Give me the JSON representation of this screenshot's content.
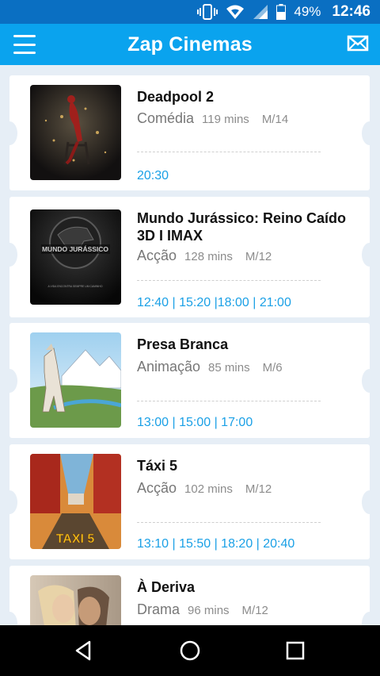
{
  "status": {
    "battery": "49%",
    "time": "12:46"
  },
  "app": {
    "title": "Zap Cinemas"
  },
  "movies": [
    {
      "title": "Deadpool 2",
      "genre": "Comédia",
      "duration": "119 mins",
      "rating": "M/14",
      "times": "20:30"
    },
    {
      "title": "Mundo Jurássico: Reino Caído 3D I IMAX",
      "genre": "Acção",
      "duration": "128 mins",
      "rating": "M/12",
      "times": "12:40 | 15:20  |18:00 | 21:00",
      "poster_text": "MUNDO JURÁSSICO",
      "poster_sub": "A VIDA ENCONTRA SEMPRE UM CAMINHO"
    },
    {
      "title": "Presa Branca",
      "genre": "Animação",
      "duration": "85 mins",
      "rating": "M/6",
      "times": "13:00 | 15:00 | 17:00"
    },
    {
      "title": "Táxi 5",
      "genre": "Acção",
      "duration": "102 mins",
      "rating": "M/12",
      "times": "13:10 | 15:50 | 18:20 | 20:40",
      "poster_text": "TAXI 5"
    },
    {
      "title": "À Deriva",
      "genre": "Drama",
      "duration": "96 mins",
      "rating": "M/12",
      "times": ""
    }
  ]
}
